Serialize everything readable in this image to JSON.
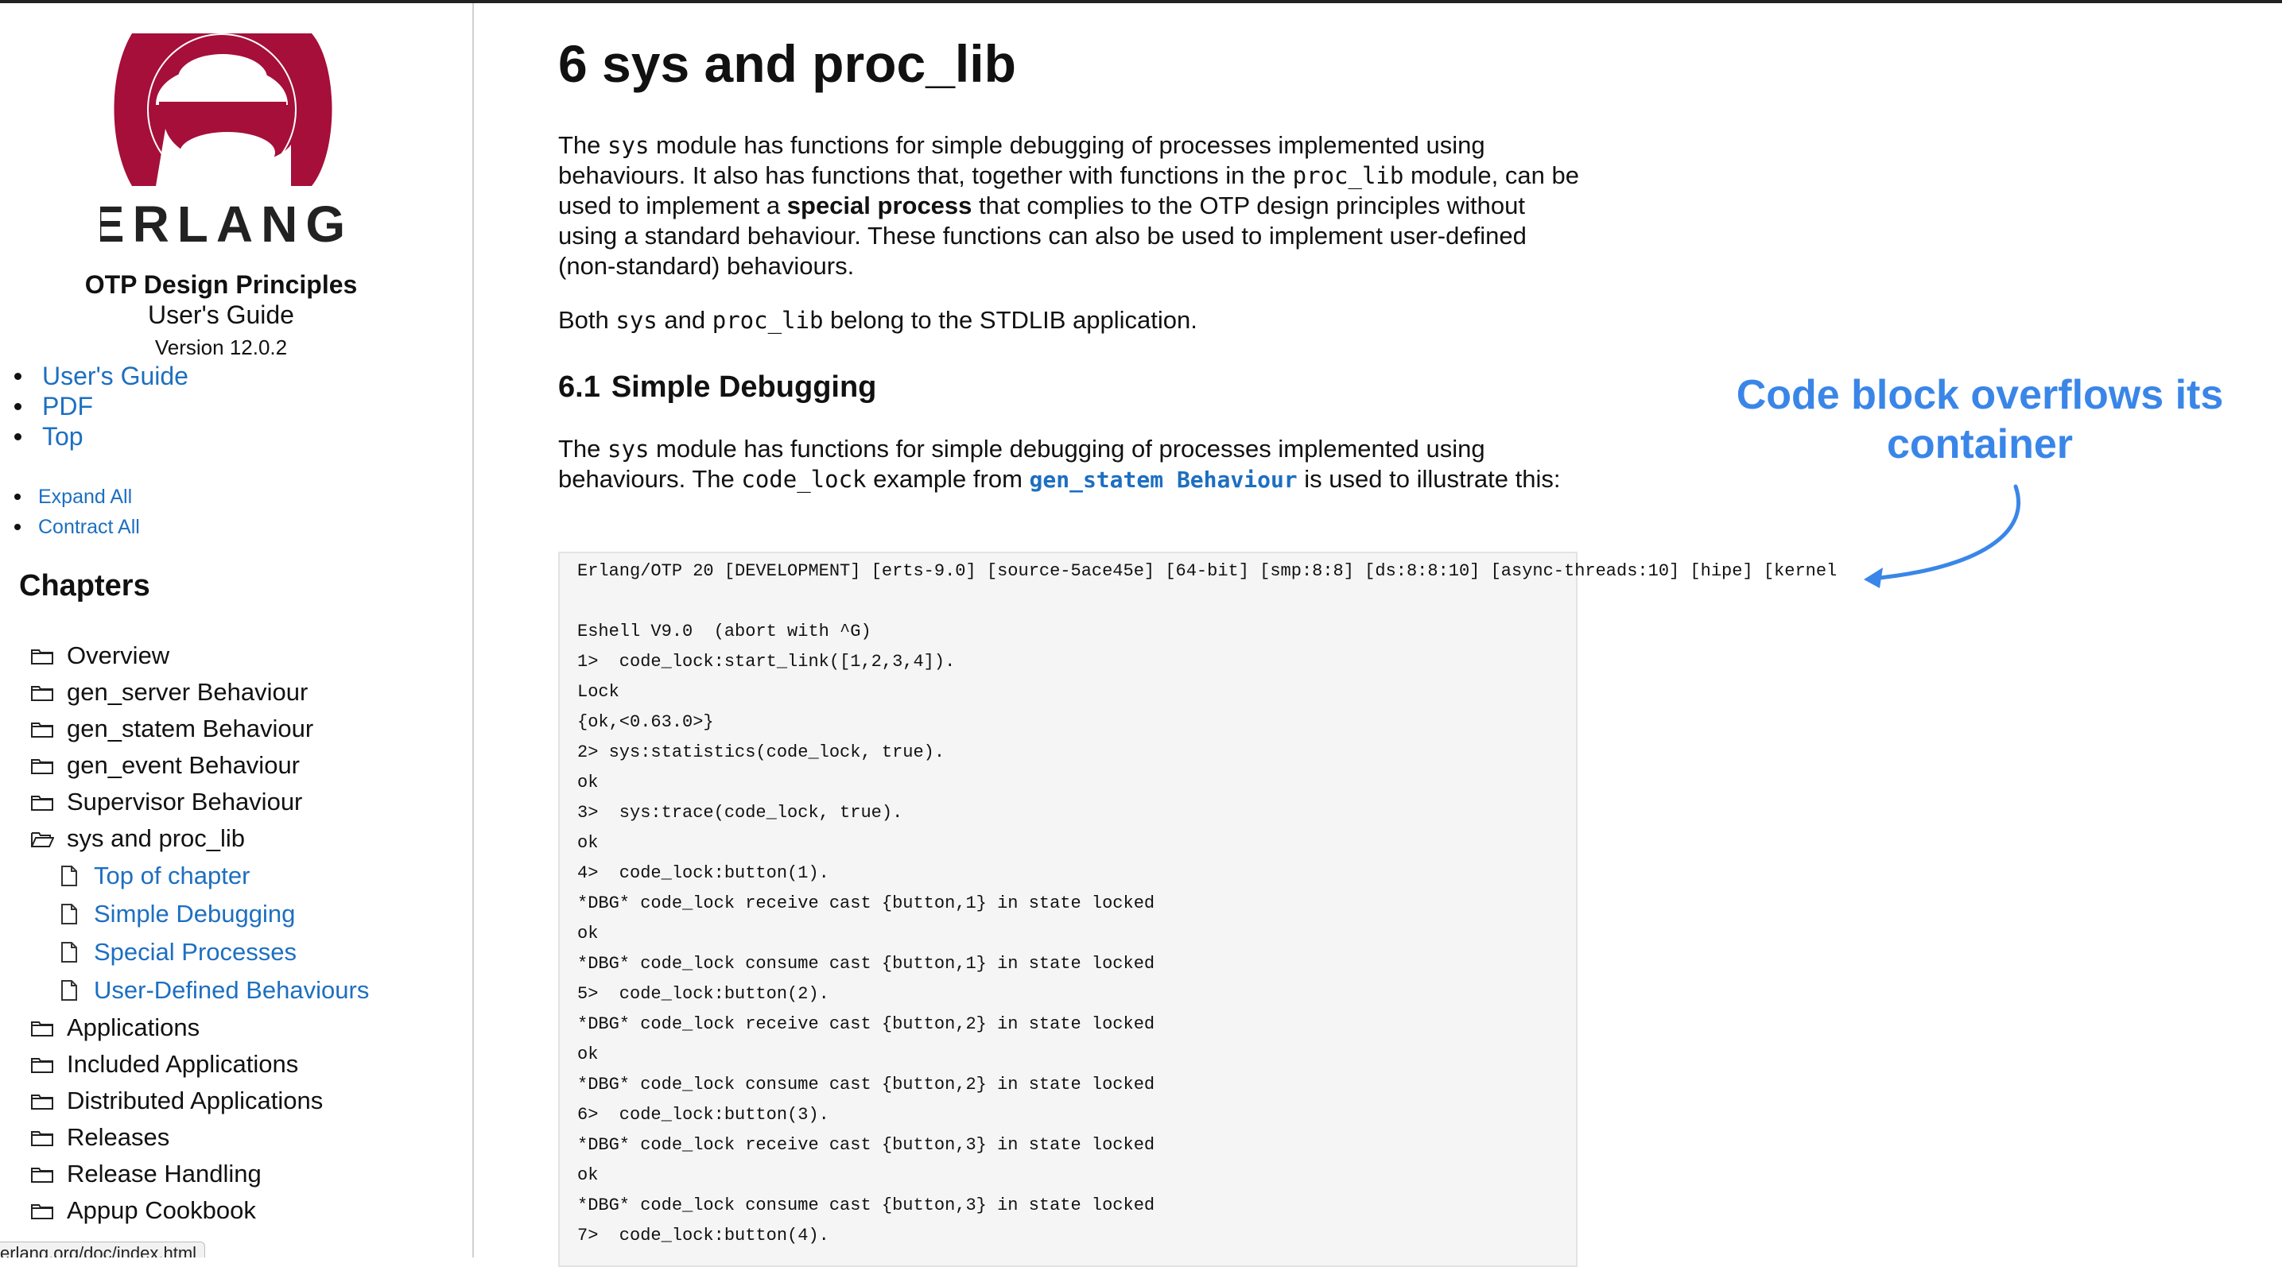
{
  "sidebar": {
    "logo_text": "ERLANG",
    "title": "OTP Design Principles",
    "subtitle": "User's Guide",
    "version": "Version 12.0.2",
    "top_links": [
      "User's Guide",
      "PDF",
      "Top"
    ],
    "expand_all": "Expand All",
    "contract_all": "Contract All",
    "chapters_heading": "Chapters",
    "chapters_before": [
      "Overview",
      "gen_server Behaviour",
      "gen_statem Behaviour",
      "gen_event Behaviour",
      "Supervisor Behaviour"
    ],
    "current_chapter": "sys and proc_lib",
    "sub_items": [
      "Top of chapter",
      "Simple Debugging",
      "Special Processes",
      "User-Defined Behaviours"
    ],
    "chapters_after": [
      "Applications",
      "Included Applications",
      "Distributed Applications",
      "Releases",
      "Release Handling",
      "Appup Cookbook"
    ],
    "status_url": "erlang.org/doc/index.html"
  },
  "main": {
    "title": "6 sys and proc_lib",
    "p1": {
      "a": "The ",
      "code1": "sys",
      "b": " module has functions for simple debugging of processes implemented using behaviours. It also has functions that, together with functions in the ",
      "code2": "proc_lib",
      "c": " module, can be used to implement a ",
      "bold": "special process",
      "d": " that complies to the OTP design principles without using a standard behaviour. These functions can also be used to implement user-defined (non-standard) behaviours."
    },
    "p2": {
      "a": "Both ",
      "code1": "sys",
      "b": " and ",
      "code2": "proc_lib",
      "c": " belong to the STDLIB application."
    },
    "section": {
      "number": "6.1",
      "title": "Simple Debugging"
    },
    "p3": {
      "a": "The ",
      "code1": "sys",
      "b": " module has functions for simple debugging of processes implemented using behaviours. The ",
      "code2": "code_lock",
      "c": " example from ",
      "link": "gen_statem Behaviour",
      "d": " is used to illustrate this:"
    },
    "code_block": "Erlang/OTP 20 [DEVELOPMENT] [erts-9.0] [source-5ace45e] [64-bit] [smp:8:8] [ds:8:8:10] [async-threads:10] [hipe] [kernel\n\nEshell V9.0  (abort with ^G)\n1>  code_lock:start_link([1,2,3,4]).\nLock\n{ok,<0.63.0>}\n2> sys:statistics(code_lock, true).\nok\n3>  sys:trace(code_lock, true).\nok\n4>  code_lock:button(1).\n*DBG* code_lock receive cast {button,1} in state locked\nok\n*DBG* code_lock consume cast {button,1} in state locked\n5>  code_lock:button(2).\n*DBG* code_lock receive cast {button,2} in state locked\nok\n*DBG* code_lock consume cast {button,2} in state locked\n6>  code_lock:button(3).\n*DBG* code_lock receive cast {button,3} in state locked\nok\n*DBG* code_lock consume cast {button,3} in state locked\n7>  code_lock:button(4)."
  },
  "annotation": {
    "text": "Code block overflows its container",
    "color": "#3a86e8"
  },
  "colors": {
    "link": "#1d6fc1",
    "logo_red": "#a50f3a",
    "code_bg": "#f5f5f5"
  }
}
